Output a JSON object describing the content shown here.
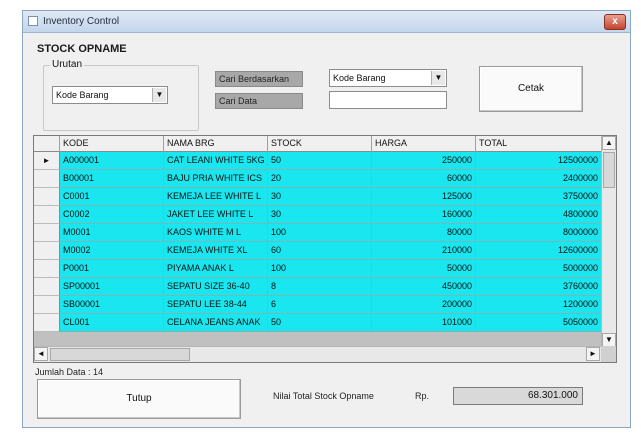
{
  "window": {
    "title": "Inventory Control",
    "close_glyph": "x"
  },
  "section_title": "STOCK OPNAME",
  "urutan": {
    "label": "Urutan",
    "selected": "Kode Barang"
  },
  "cari_berdasarkan": {
    "label": "Cari Berdasarkan",
    "selected": "Kode Barang"
  },
  "cari_data": {
    "label": "Cari Data",
    "value": ""
  },
  "buttons": {
    "cetak": "Cetak",
    "tutup": "Tutup"
  },
  "table": {
    "columns": [
      "KODE",
      "NAMA BRG",
      "STOCK",
      "HARGA",
      "TOTAL"
    ],
    "rows": [
      [
        "A000001",
        "CAT LEANI WHITE 5KG",
        "50",
        "250000",
        "12500000"
      ],
      [
        "B00001",
        "BAJU PRIA WHITE ICS",
        "20",
        "60000",
        "2400000"
      ],
      [
        "C0001",
        "KEMEJA LEE WHITE L",
        "30",
        "125000",
        "3750000"
      ],
      [
        "C0002",
        "JAKET LEE WHITE L",
        "30",
        "160000",
        "4800000"
      ],
      [
        "M0001",
        "KAOS WHITE M L",
        "100",
        "80000",
        "8000000"
      ],
      [
        "M0002",
        "KEMEJA WHITE XL",
        "60",
        "210000",
        "12600000"
      ],
      [
        "P0001",
        "PIYAMA ANAK L",
        "100",
        "50000",
        "5000000"
      ],
      [
        "SP00001",
        "SEPATU SIZE 36-40",
        "8",
        "450000",
        "3760000"
      ],
      [
        "SB00001",
        "SEPATU LEE 38-44",
        "6",
        "200000",
        "1200000"
      ],
      [
        "CL001",
        "CELANA JEANS ANAK",
        "50",
        "101000",
        "5050000"
      ]
    ]
  },
  "jumlah_data": "Jumlah Data : 14",
  "total": {
    "label": "Nilai Total Stock Opname",
    "currency": "Rp.",
    "value": "68.301.000"
  }
}
